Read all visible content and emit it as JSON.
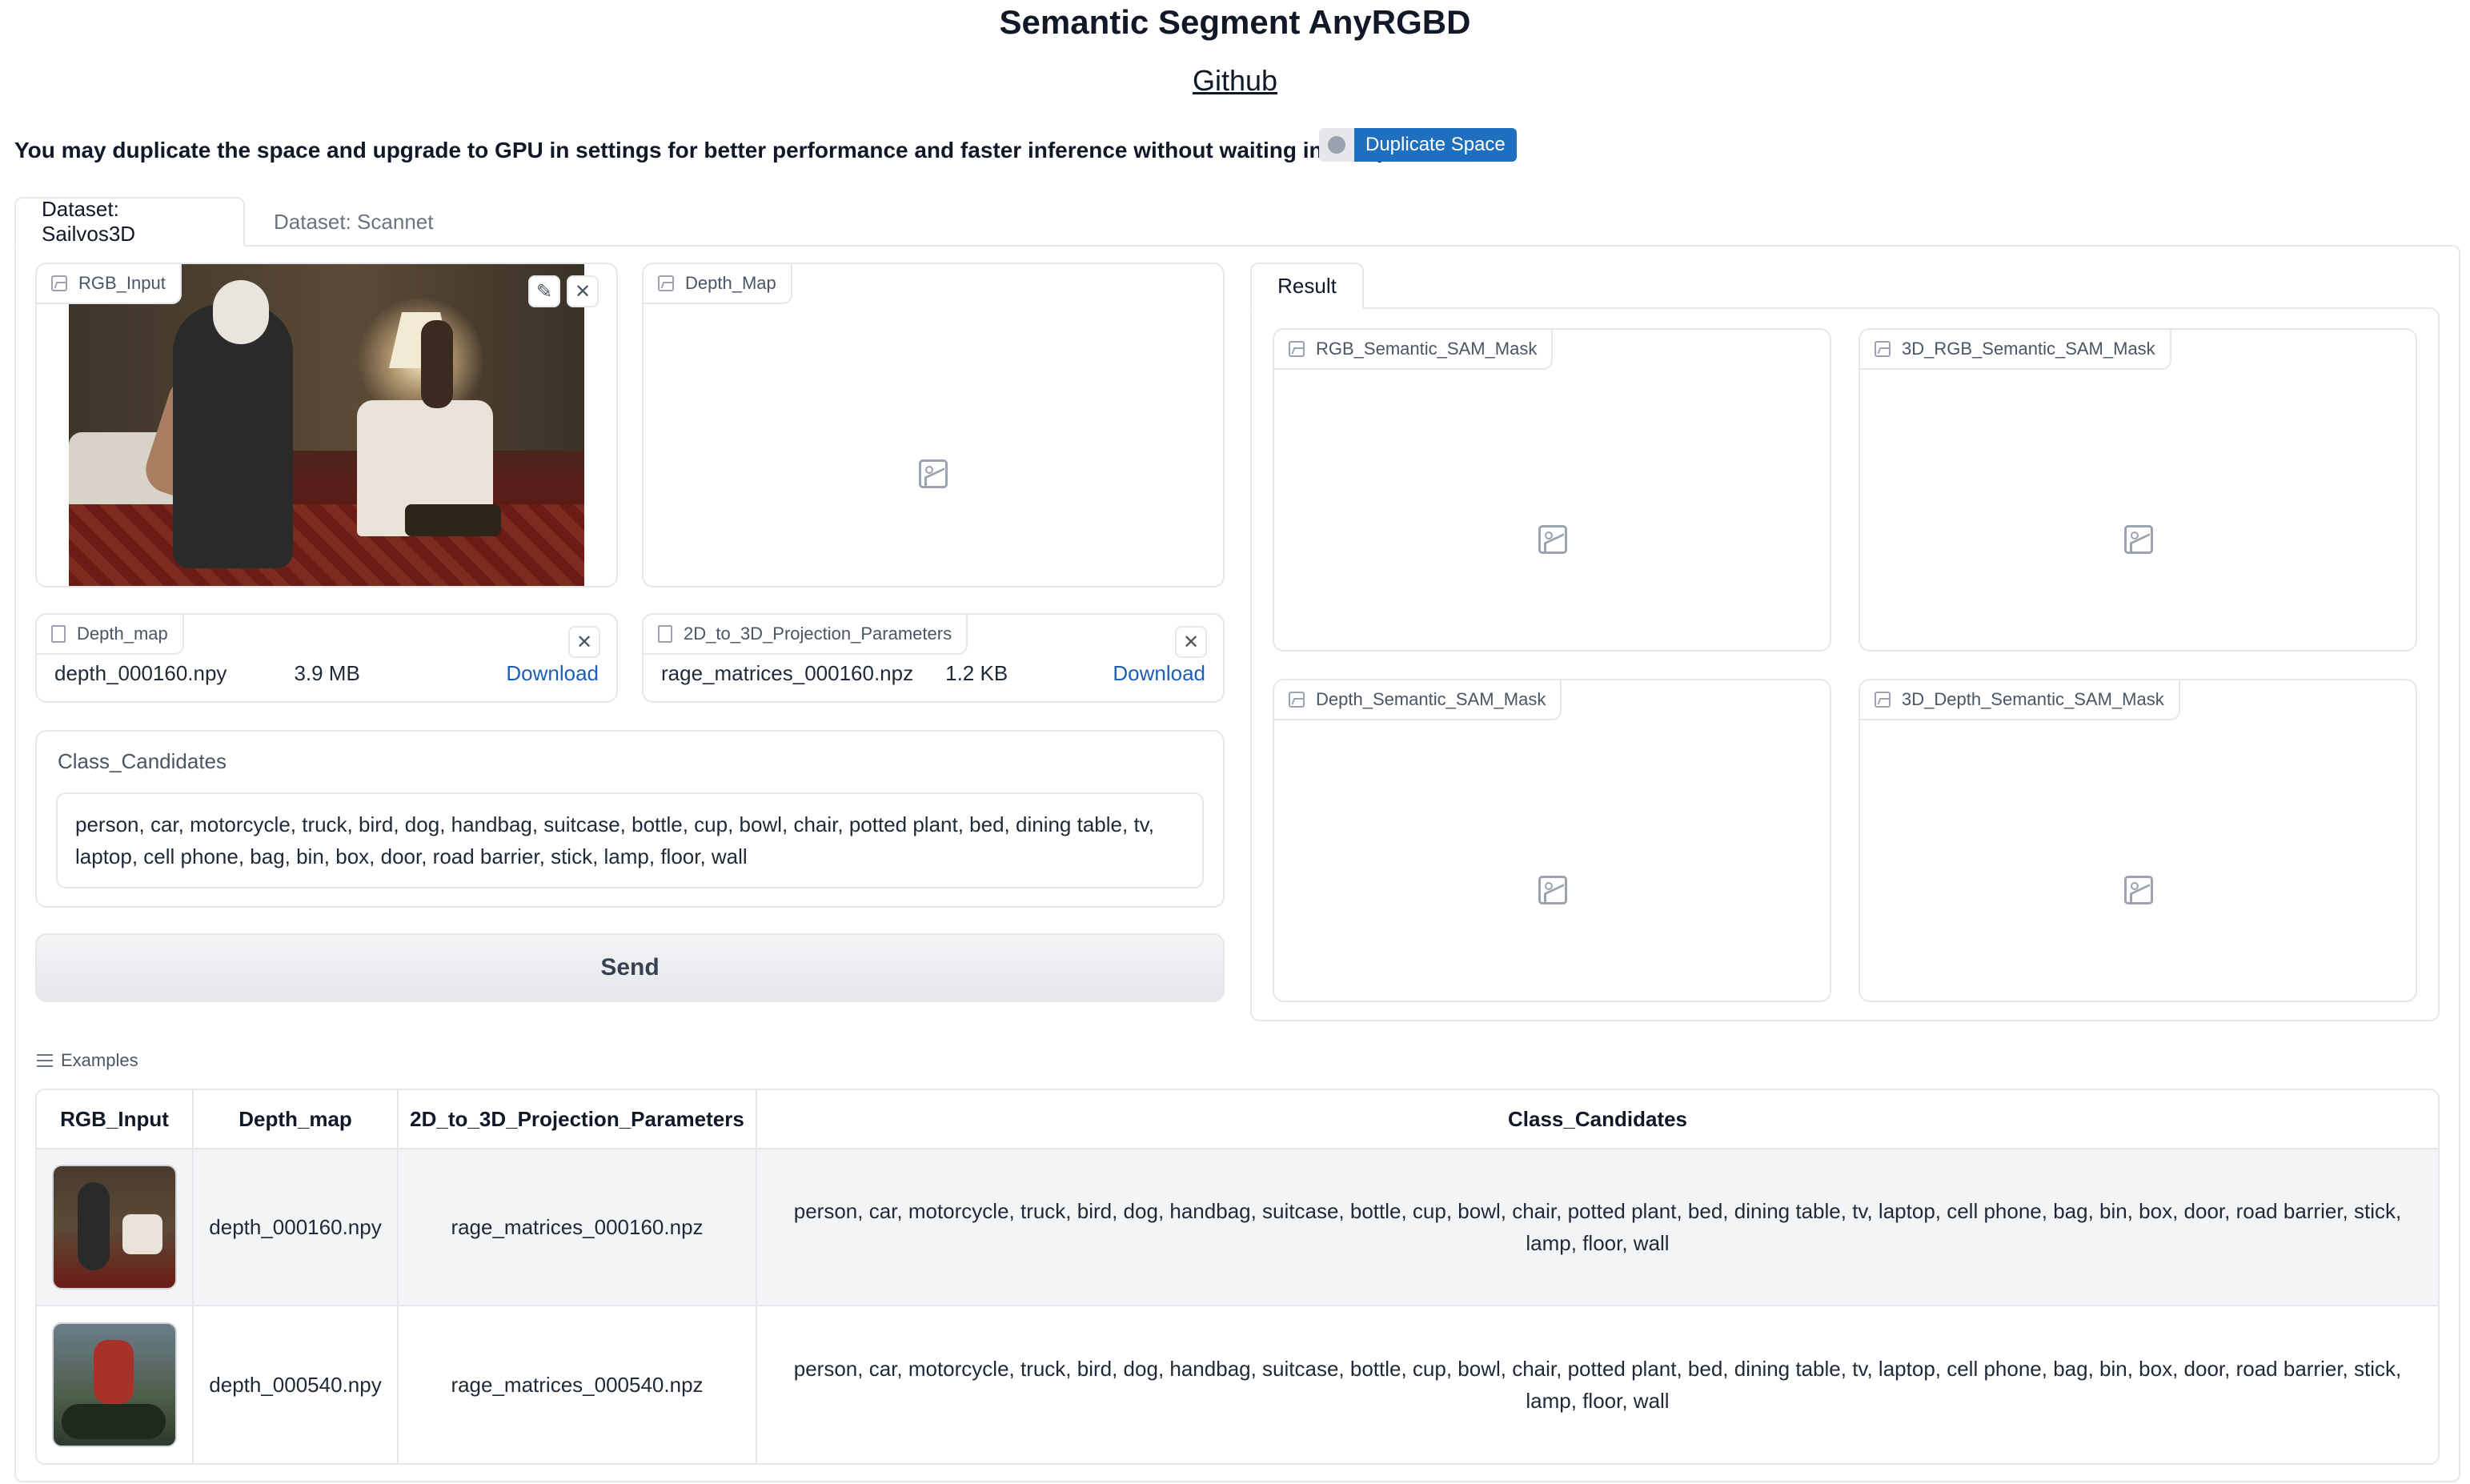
{
  "header": {
    "title": "Semantic Segment AnyRGBD",
    "github_link": "Github",
    "notice": "You may duplicate the space and upgrade to GPU in settings for better performance and faster inference without waiting in the queue.",
    "duplicate_button": "Duplicate Space"
  },
  "tabs": [
    {
      "label": "Dataset: Sailvos3D",
      "active": true
    },
    {
      "label": "Dataset: Scannet",
      "active": false
    }
  ],
  "inputs": {
    "rgb_label": "RGB_Input",
    "depth_map_label": "Depth_Map",
    "depth_file_label": "Depth_map",
    "depth_file": {
      "name": "depth_000160.npy",
      "size": "3.9 MB",
      "download": "Download"
    },
    "proj_label": "2D_to_3D_Projection_Parameters",
    "proj_file": {
      "name": "rage_matrices_000160.npz",
      "size": "1.2 KB",
      "download": "Download"
    },
    "class_label": "Class_Candidates",
    "class_value": "person, car, motorcycle, truck, bird, dog, handbag, suitcase, bottle, cup, bowl, chair, potted plant, bed, dining table, tv, laptop, cell phone, bag, bin, box, door, road barrier, stick, lamp, floor, wall",
    "send_button": "Send"
  },
  "result": {
    "tab_label": "Result",
    "outputs": [
      "RGB_Semantic_SAM_Mask",
      "3D_RGB_Semantic_SAM_Mask",
      "Depth_Semantic_SAM_Mask",
      "3D_Depth_Semantic_SAM_Mask"
    ]
  },
  "examples": {
    "label": "Examples",
    "headers": [
      "RGB_Input",
      "Depth_map",
      "2D_to_3D_Projection_Parameters",
      "Class_Candidates"
    ],
    "rows": [
      {
        "depth": "depth_000160.npy",
        "proj": "rage_matrices_000160.npz",
        "classes": "person, car, motorcycle, truck, bird, dog, handbag, suitcase, bottle, cup, bowl, chair, potted plant, bed, dining table, tv, laptop, cell phone, bag, bin, box, door, road barrier, stick, lamp, floor, wall"
      },
      {
        "depth": "depth_000540.npy",
        "proj": "rage_matrices_000540.npz",
        "classes": "person, car, motorcycle, truck, bird, dog, handbag, suitcase, bottle, cup, bowl, chair, potted plant, bed, dining table, tv, laptop, cell phone, bag, bin, box, door, road barrier, stick, lamp, floor, wall"
      }
    ]
  },
  "colors": {
    "accent": "#1e6fbf",
    "link": "#1d5fb4",
    "border": "#e5e7eb"
  },
  "icons": [
    "image-icon",
    "file-icon",
    "edit-icon",
    "close-icon",
    "list-icon",
    "toggle-icon"
  ]
}
